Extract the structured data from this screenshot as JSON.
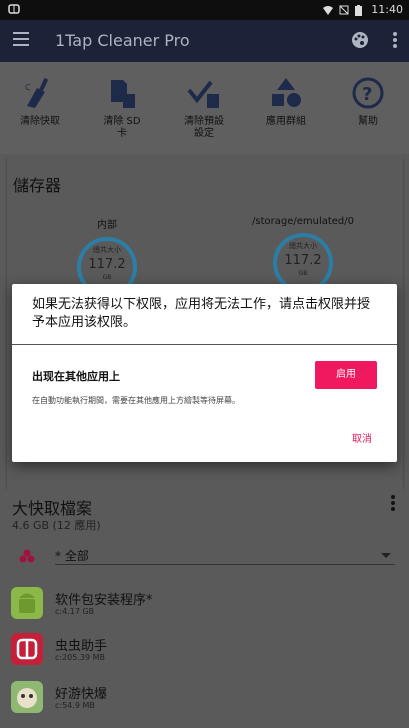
{
  "status_bar": {
    "time": "11:40",
    "left_icon": "bug-icon"
  },
  "app_bar": {
    "title": "1Tap Cleaner Pro"
  },
  "tools": [
    {
      "label": "清除快取",
      "icon": "broom-icon"
    },
    {
      "label": "清除 SD\n卡",
      "icon": "sd-card-icon"
    },
    {
      "label": "清除預設\n設定",
      "icon": "check-trash-icon"
    },
    {
      "label": "應用群組",
      "icon": "shapes-icon"
    },
    {
      "label": "幫助",
      "icon": "help-icon"
    }
  ],
  "storage": {
    "heading": "儲存器",
    "internal": {
      "name": "内部",
      "label": "總共大小",
      "value": "117.2",
      "unit": "GB"
    },
    "external": {
      "name": "/storage/emulated/0",
      "label": "總共大小",
      "value": "117.2",
      "unit": "GB"
    }
  },
  "dialog": {
    "message": "如果无法获得以下权限，应用将无法工作，请点击权限并授予本应用该权限。",
    "permission_title": "出现在其他应用上",
    "permission_desc": "在自動功能執行期間，需要在其他應用上方繪製等待屏幕。",
    "enable_label": "启用",
    "cancel_label": "取消"
  },
  "cache": {
    "heading": "大快取檔案",
    "summary": "4.6 GB (12 應用)",
    "filter_value": "* 全部",
    "apps": [
      {
        "name": "软件包安装程序*",
        "size": "c:4.17 GB",
        "icon": "android-icon"
      },
      {
        "name": "虫虫助手",
        "size": "c:205.39 MB",
        "icon": "bug-app-icon"
      },
      {
        "name": "好游快爆",
        "size": "c:54.9 MB",
        "icon": "game-app-icon"
      }
    ]
  }
}
